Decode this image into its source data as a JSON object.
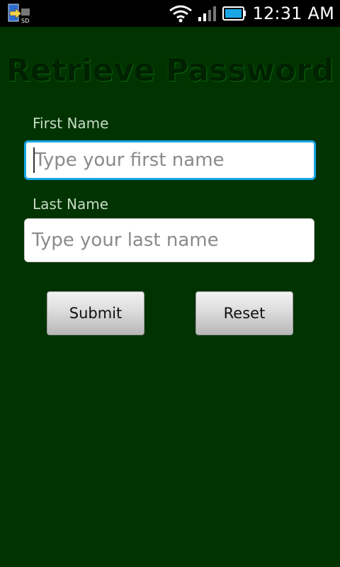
{
  "status_bar": {
    "time": "12:31 AM",
    "icons": [
      "sd-card-transfer-icon",
      "wifi-icon",
      "cell-signal-icon",
      "battery-icon"
    ],
    "battery_color": "#19a6e6"
  },
  "page": {
    "title": "Retrieve Password",
    "background_color": "#003300",
    "first_name": {
      "label": "First Name",
      "value": "",
      "placeholder": "Type your first name",
      "focused": true,
      "focus_color": "#19a6e6"
    },
    "last_name": {
      "label": "Last Name",
      "value": "",
      "placeholder": "Type your last name"
    },
    "buttons": {
      "submit": "Submit",
      "reset": "Reset"
    }
  }
}
